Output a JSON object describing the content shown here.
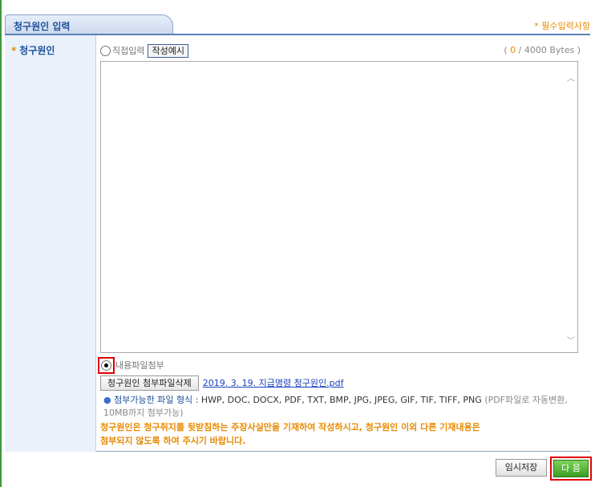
{
  "header": {
    "tab_title": "청구원인 입력",
    "required_note": "* 필수입력사항"
  },
  "form": {
    "field_label": "청구원인",
    "field_bullet": "*",
    "direct_input": {
      "label": "직접입력",
      "selected": false,
      "example_button": "작성예시"
    },
    "byte_counter": {
      "open": "( ",
      "current": "0",
      "rest": " / 4000 Bytes )"
    },
    "textarea_value": "",
    "file_attach": {
      "label": "내용파일첨부",
      "selected": true
    },
    "delete_button": "청구원인 첨부파일삭제",
    "attached_file": "2019. 3. 19. 지급명령 청구원인.pdf",
    "format_info": {
      "bullet": "●",
      "title": "첨부가능한 파일 형식 :",
      "formats": " HWP, DOC, DOCX, PDF, TXT, BMP, JPG, JPEG, GIF, TIF, TIFF, PNG",
      "note": " (PDF파일로 자동변환, 10MB까지 첨부가능)"
    },
    "warning_line1": "청구원인은 청구취지를 뒷받침하는 주장사실만을 기재하여 작성하시고, 청구원인 이외 다른 기재내용은",
    "warning_line2": "첨부되지 않도록 하여 주시기 바랍니다."
  },
  "buttons": {
    "temp_save": "임시저장",
    "next": "다 음"
  },
  "colors": {
    "accent_blue": "#1d4f99",
    "orange": "#e88a00",
    "green": "#3c9c24",
    "highlight_red": "#e00000"
  },
  "icons": {
    "scroll_up": "chevron-up-icon",
    "scroll_down": "chevron-down-icon"
  }
}
